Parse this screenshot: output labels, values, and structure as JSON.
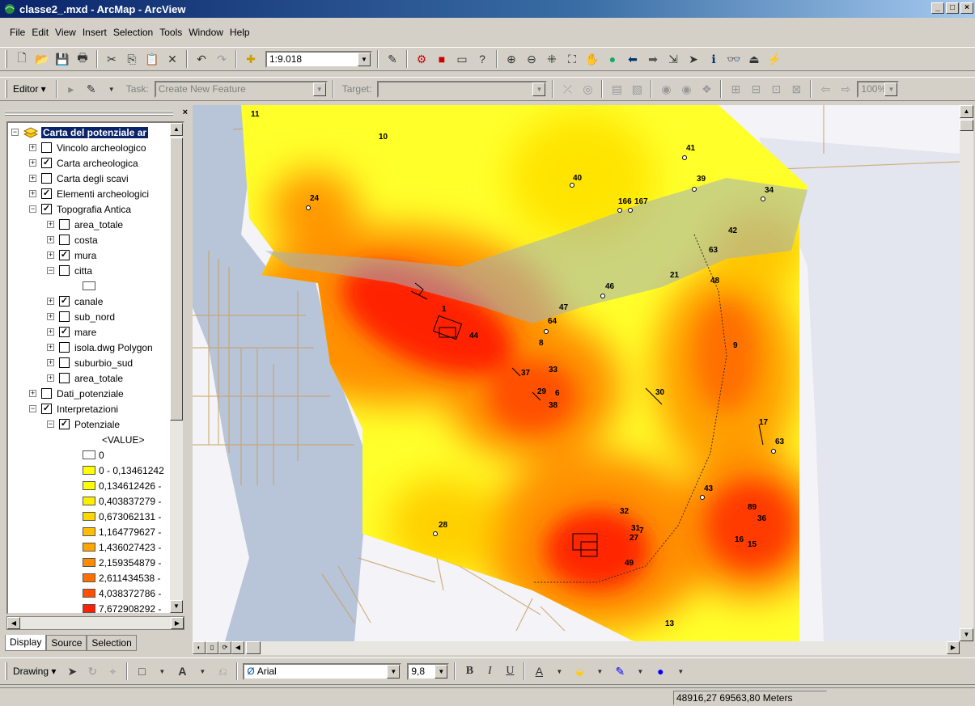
{
  "window": {
    "title": "classe2_.mxd - ArcMap - ArcView",
    "min": "_",
    "max": "□",
    "close": "×"
  },
  "menu": [
    "File",
    "Edit",
    "View",
    "Insert",
    "Selection",
    "Tools",
    "Window",
    "Help"
  ],
  "standard_toolbar": {
    "scale": "1:9.018"
  },
  "editor_toolbar": {
    "editor_label": "Editor ▾",
    "task_label": "Task:",
    "task_value": "Create New Feature",
    "target_label": "Target:",
    "zoom": "100%"
  },
  "toc": {
    "root": "Carta del potenziale ar",
    "items": [
      {
        "label": "Vincolo archeologico",
        "checked": false
      },
      {
        "label": "Carta archeologica",
        "checked": true
      },
      {
        "label": "Carta degli  scavi",
        "checked": false
      },
      {
        "label": "Elementi archeologici",
        "checked": true
      },
      {
        "label": "Topografia Antica",
        "checked": true
      },
      {
        "label": "area_totale",
        "checked": false
      },
      {
        "label": "costa",
        "checked": false
      },
      {
        "label": "mura",
        "checked": true
      },
      {
        "label": "citta",
        "checked": false
      },
      {
        "label": "canale",
        "checked": true
      },
      {
        "label": "sub_nord",
        "checked": false
      },
      {
        "label": "mare",
        "checked": true
      },
      {
        "label": "isola.dwg Polygon",
        "checked": false
      },
      {
        "label": "suburbio_sud",
        "checked": false
      },
      {
        "label": "area_totale",
        "checked": false
      },
      {
        "label": "Dati_potenziale",
        "checked": false
      },
      {
        "label": "Interpretazioni",
        "checked": true
      },
      {
        "label": "Potenziale",
        "checked": true
      }
    ],
    "value_header": "<VALUE>",
    "legend": [
      {
        "label": "0",
        "color": "#ffffff"
      },
      {
        "label": "0 - 0,13461242",
        "color": "#ffff00"
      },
      {
        "label": "0,134612426 -",
        "color": "#ffff00"
      },
      {
        "label": "0,403837279 -",
        "color": "#ffee00"
      },
      {
        "label": "0,673062131 -",
        "color": "#ffd700"
      },
      {
        "label": "1,164779627 -",
        "color": "#ffbf00"
      },
      {
        "label": "1,436027423 -",
        "color": "#ffa500"
      },
      {
        "label": "2,159354879 -",
        "color": "#ff8c00"
      },
      {
        "label": "2,611434538 -",
        "color": "#ff7000"
      },
      {
        "label": "4,038372786 -",
        "color": "#ff5000"
      },
      {
        "label": "7,672908292 -",
        "color": "#ff2000"
      }
    ],
    "tabs": [
      "Display",
      "Source",
      "Selection"
    ]
  },
  "map_labels": [
    "11",
    "10",
    "24",
    "40",
    "166",
    "167",
    "41",
    "39",
    "34",
    "42",
    "63",
    "21",
    "48",
    "46",
    "47",
    "64",
    "1",
    "44",
    "8",
    "33",
    "37",
    "29",
    "6",
    "38",
    "30",
    "9",
    "17",
    "63",
    "43",
    "32",
    "31",
    "7",
    "89",
    "36",
    "28",
    "27",
    "49",
    "16",
    "15",
    "13"
  ],
  "drawing_toolbar": {
    "drawing_label": "Drawing ▾",
    "font": "Arial",
    "size": "9,8",
    "bold": "B",
    "italic": "I",
    "underline": "U"
  },
  "status": {
    "coords": "48916,27  69563,80 Meters"
  }
}
